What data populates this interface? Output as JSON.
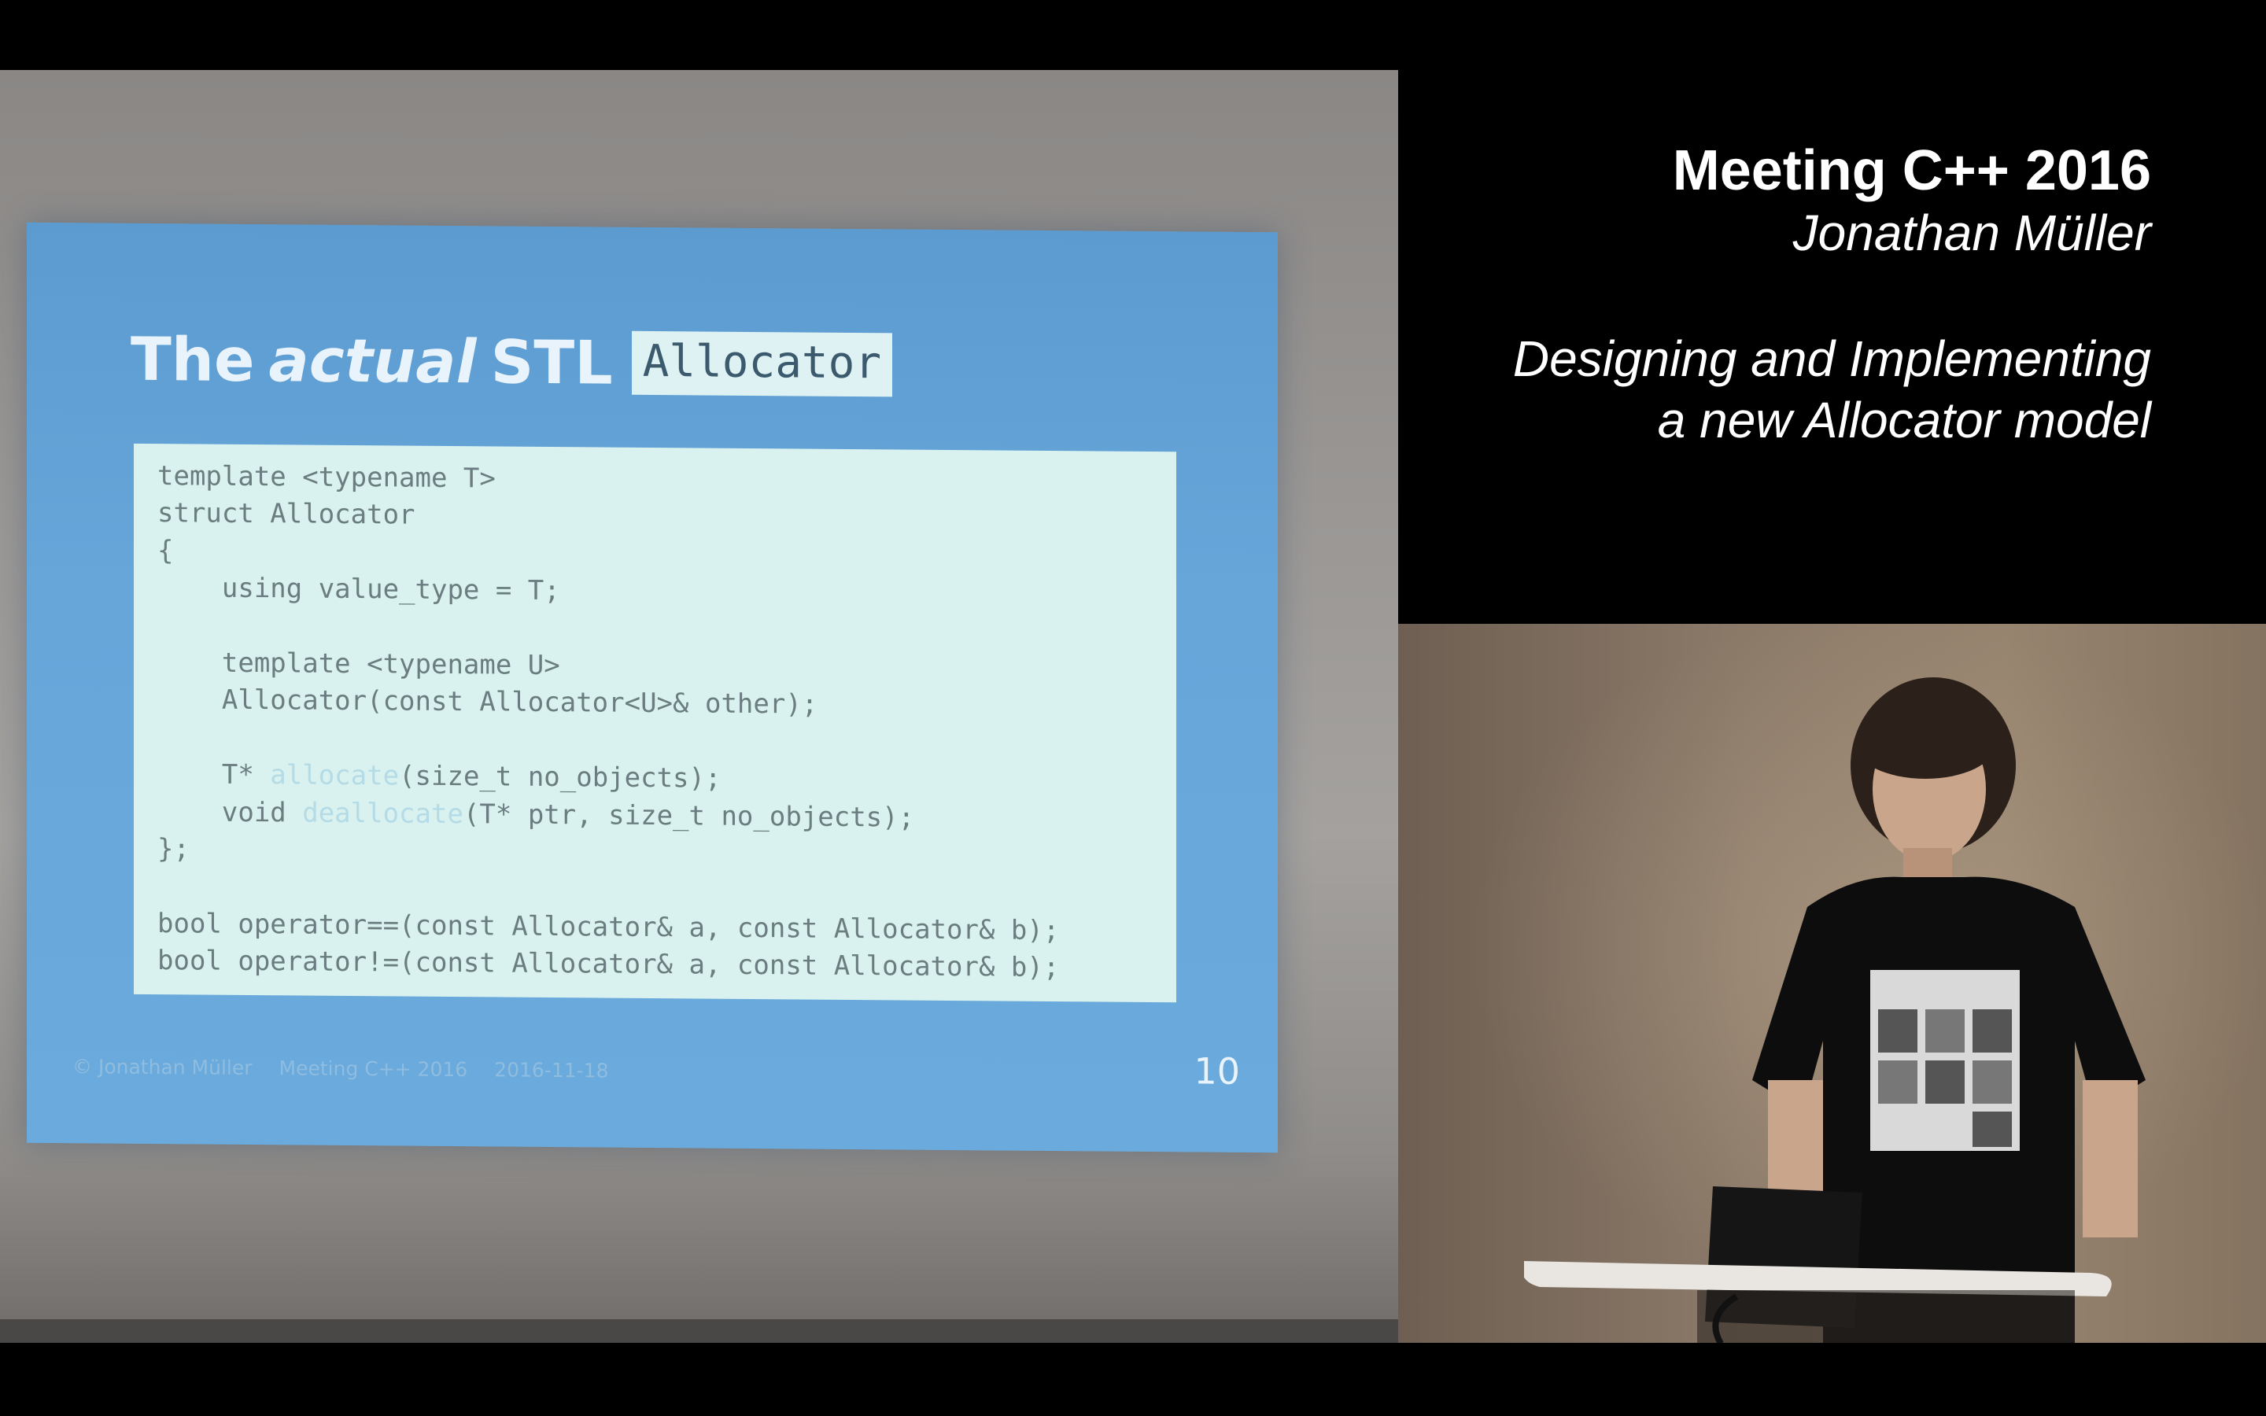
{
  "slide": {
    "title_prefix": "The",
    "title_emphasis": "actual",
    "title_suffix": "STL",
    "title_code": "Allocator",
    "code_lines": [
      "template <typename T>",
      "struct Allocator",
      "{",
      "    using value_type = T;",
      "",
      "    template <typename U>",
      "    Allocator(const Allocator<U>& other);",
      "",
      "    T* allocate(size_t no_objects);",
      "    void deallocate(T* ptr, size_t no_objects);",
      "};",
      "",
      "bool operator==(const Allocator& a, const Allocator& b);",
      "bool operator!=(const Allocator& a, const Allocator& b);"
    ],
    "footer": {
      "author": "© Jonathan Müller",
      "event": "Meeting C++ 2016",
      "date": "2016-11-18"
    },
    "page_number": "10"
  },
  "talk": {
    "event": "Meeting C++ 2016",
    "speaker": "Jonathan Müller",
    "title_line1": "Designing and Implementing",
    "title_line2": "a new Allocator model"
  },
  "colors": {
    "background": "#000000",
    "slide_blue": "#66a6d9",
    "code_background": "#d9f2ef",
    "title_text": "#ffffff"
  }
}
